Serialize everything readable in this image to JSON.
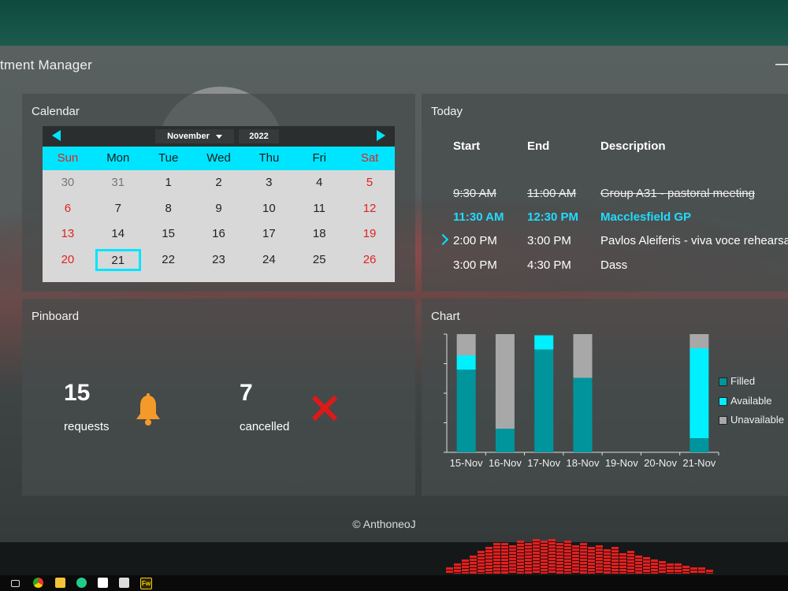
{
  "app": {
    "title": "tment Manager",
    "minimize_glyph": "—"
  },
  "calendar": {
    "title": "Calendar",
    "month": "November",
    "year": "2022",
    "weekdays": [
      "Sun",
      "Mon",
      "Tue",
      "Wed",
      "Thu",
      "Fri",
      "Sat"
    ],
    "weeks": [
      [
        "30",
        "31",
        "1",
        "2",
        "3",
        "4",
        "5"
      ],
      [
        "6",
        "7",
        "8",
        "9",
        "10",
        "11",
        "12"
      ],
      [
        "13",
        "14",
        "15",
        "16",
        "17",
        "18",
        "19"
      ],
      [
        "20",
        "21",
        "22",
        "23",
        "24",
        "25",
        "26"
      ]
    ],
    "selected": "21",
    "accent": "#00e5ff",
    "weekend_color": "#e02222"
  },
  "today": {
    "title": "Today",
    "columns": {
      "start": "Start",
      "end": "End",
      "description": "Description"
    },
    "events": [
      {
        "start": "9:30 AM",
        "end": "11:00 AM",
        "description": "Group A31 - pastoral meeting",
        "state": "past"
      },
      {
        "start": "11:30 AM",
        "end": "12:30 PM",
        "description": "Macclesfield GP",
        "state": "current"
      },
      {
        "start": "2:00 PM",
        "end": "3:00 PM",
        "description": "Pavlos Aleiferis - viva voce rehearsa",
        "state": "next"
      },
      {
        "start": "3:00 PM",
        "end": "4:30 PM",
        "description": "Dass",
        "state": "upcoming"
      }
    ]
  },
  "pinboard": {
    "title": "Pinboard",
    "requests": {
      "count": "15",
      "label": "requests",
      "icon": "bell-icon"
    },
    "cancelled": {
      "count": "7",
      "label": "cancelled",
      "icon": "cross-icon"
    }
  },
  "chart_panel": {
    "title": "Chart"
  },
  "chart_data": {
    "type": "bar",
    "stacked": true,
    "categories": [
      "15-Nov",
      "16-Nov",
      "17-Nov",
      "18-Nov",
      "19-Nov",
      "20-Nov",
      "21-Nov"
    ],
    "series": [
      {
        "name": "Filled",
        "color": "#00959c",
        "values": [
          7,
          2,
          8.7,
          6.3,
          0,
          0,
          1.2
        ]
      },
      {
        "name": "Available",
        "color": "#00f0ff",
        "values": [
          1.2,
          0,
          1.2,
          0,
          0,
          0,
          7.6
        ]
      },
      {
        "name": "Unavailable",
        "color": "#a8a8a8",
        "values": [
          1.8,
          8,
          0,
          3.7,
          0,
          0,
          1.2
        ]
      }
    ],
    "ylim": [
      0,
      10
    ],
    "legend_position": "right"
  },
  "footer": {
    "copyright": "© AnthoneoJ"
  },
  "taskbar": {
    "icons": [
      "task-view-icon",
      "chrome-icon",
      "file-explorer-icon",
      "browser-icon",
      "app-icon",
      "wolf-icon",
      "fireworks-icon"
    ],
    "fireworks_label": "Fw"
  }
}
